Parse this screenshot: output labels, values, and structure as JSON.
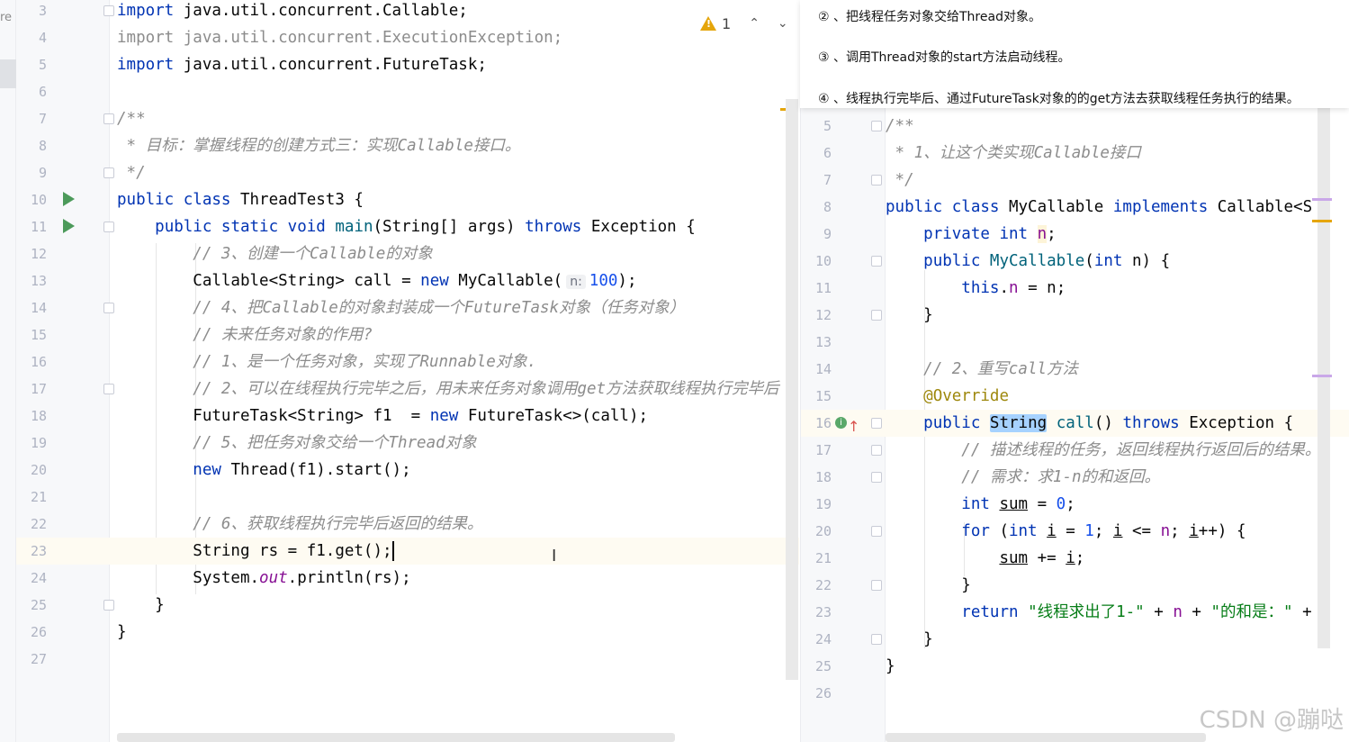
{
  "left_sidebar": {
    "label": "re"
  },
  "left_editor": {
    "warnings": {
      "count": "1"
    },
    "lines": [
      {
        "n": "3",
        "code": "<span class=\"kw\">import</span> java.util.concurrent.Callable;"
      },
      {
        "n": "4",
        "code": "<span class=\"cm\" style=\"font-style:normal\">import java.util.concurrent.ExecutionException;</span>"
      },
      {
        "n": "5",
        "code": "<span class=\"kw\">import</span> java.util.concurrent.FutureTask;"
      },
      {
        "n": "6",
        "code": ""
      },
      {
        "n": "7",
        "code": "<span class=\"cm\">/**</span>"
      },
      {
        "n": "8",
        "code": "<span class=\"cm\"> * 目标：掌握线程的创建方式三：实现Callable接口。</span>"
      },
      {
        "n": "9",
        "code": "<span class=\"cm\"> */</span>"
      },
      {
        "n": "10",
        "code": "<span class=\"kw\">public class</span> ThreadTest3 {"
      },
      {
        "n": "11",
        "code": "    <span class=\"kw\">public static void</span> <span class=\"fn\">main</span>(String[] args) <span class=\"kw\">throws</span> Exception {"
      },
      {
        "n": "12",
        "code": "        <span class=\"cm\">// 3、创建一个Callable的对象</span>"
      },
      {
        "n": "13",
        "code": "        Callable&lt;String&gt; call = <span class=\"kw\">new</span> MyCallable(<span class=\"hint\">n:</span><span class=\"num\">100</span>);"
      },
      {
        "n": "14",
        "code": "        <span class=\"cm\">// 4、把Callable的对象封装成一个FutureTask对象（任务对象）</span>"
      },
      {
        "n": "15",
        "code": "        <span class=\"cm\">// 未来任务对象的作用?</span>"
      },
      {
        "n": "16",
        "code": "        <span class=\"cm\">// 1、是一个任务对象，实现了Runnable对象.</span>"
      },
      {
        "n": "17",
        "code": "        <span class=\"cm\">// 2、可以在线程执行完毕之后，用未来任务对象调用get方法获取线程执行完毕后</span>"
      },
      {
        "n": "18",
        "code": "        FutureTask&lt;String&gt; f1  = <span class=\"kw\">new</span> FutureTask&lt;&gt;(call);"
      },
      {
        "n": "19",
        "code": "        <span class=\"cm\">// 5、把任务对象交给一个Thread对象</span>"
      },
      {
        "n": "20",
        "code": "        <span class=\"kw\">new</span> Thread(f1).start();"
      },
      {
        "n": "21",
        "code": ""
      },
      {
        "n": "22",
        "code": "        <span class=\"cm\">// 6、获取线程执行完毕后返回的结果。</span>"
      },
      {
        "n": "23",
        "code": "        String rs = f1.get();<span class=\"caret\"></span>"
      },
      {
        "n": "24",
        "code": "        System.<span class=\"st\">out</span>.println(rs);"
      },
      {
        "n": "25",
        "code": "    }"
      },
      {
        "n": "26",
        "code": "}"
      },
      {
        "n": "27",
        "code": ""
      }
    ]
  },
  "popup_steps": [
    "②  、把线程任务对象交给Thread对象。",
    "③  、调用Thread对象的start方法启动线程。",
    "④  、线程执行完毕后、通过FutureTask对象的的get方法去获取线程任务执行的结果。"
  ],
  "right_editor": {
    "lines": [
      {
        "n": "5",
        "code": "<span class=\"cm\">/**</span>"
      },
      {
        "n": "6",
        "code": "<span class=\"cm\"> * 1、让这个类实现Callable接口</span>"
      },
      {
        "n": "7",
        "code": "<span class=\"cm\"> */</span>"
      },
      {
        "n": "8",
        "code": "<span class=\"kw\">public class</span> MyCallable <span class=\"kw\">implements</span> Callable&lt;S"
      },
      {
        "n": "9",
        "code": "    <span class=\"kw\">private int</span> <span class=\"fld\" style=\"background:#fdf4d8\">n</span>;"
      },
      {
        "n": "10",
        "code": "    <span class=\"kw\">public</span> <span class=\"fn\">MyCallable</span>(<span class=\"kw\">int</span> n) {"
      },
      {
        "n": "11",
        "code": "        <span class=\"kw\">this</span>.<span class=\"fld\">n</span> = n;"
      },
      {
        "n": "12",
        "code": "    }"
      },
      {
        "n": "13",
        "code": ""
      },
      {
        "n": "14",
        "code": "    <span class=\"cm\">// 2、重写call方法</span>"
      },
      {
        "n": "15",
        "code": "    <span class=\"an\">@Override</span>"
      },
      {
        "n": "16",
        "code": "    <span class=\"kw\">public</span> <span class=\"hl\">String</span> <span class=\"fn\">call</span>() <span class=\"kw\">throws</span> Exception {"
      },
      {
        "n": "17",
        "code": "        <span class=\"cm\">// 描述线程的任务，返回线程执行返回后的结果。</span>"
      },
      {
        "n": "18",
        "code": "        <span class=\"cm\">// 需求：求1-n的和返回。</span>"
      },
      {
        "n": "19",
        "code": "        <span class=\"kw\">int</span> <span class=\"ul\">sum</span> = <span class=\"num\">0</span>;"
      },
      {
        "n": "20",
        "code": "        <span class=\"kw\">for</span> (<span class=\"kw\">int</span> <span class=\"ul\">i</span> = <span class=\"num\">1</span>; <span class=\"ul\">i</span> &lt;= <span class=\"fld\">n</span>; <span class=\"ul\">i</span>++) {"
      },
      {
        "n": "21",
        "code": "            <span class=\"ul\">sum</span> += <span class=\"ul\">i</span>;"
      },
      {
        "n": "22",
        "code": "        }"
      },
      {
        "n": "23",
        "code": "        <span class=\"kw\">return</span> <span class=\"str\">\"线程求出了1-\"</span> + <span class=\"fld\">n</span> + <span class=\"str\">\"的和是：\"</span> +"
      },
      {
        "n": "24",
        "code": "    }"
      },
      {
        "n": "25",
        "code": "}"
      },
      {
        "n": "26",
        "code": ""
      }
    ]
  },
  "watermark": "CSDN @蹦哒",
  "colors": {
    "accent": "#3574f0",
    "keyword": "#0033b3",
    "comment": "#8c8c8c",
    "string": "#067d17",
    "number": "#1750eb",
    "field": "#871094",
    "warning": "#e5a50a",
    "run": "#4c9a5a"
  }
}
